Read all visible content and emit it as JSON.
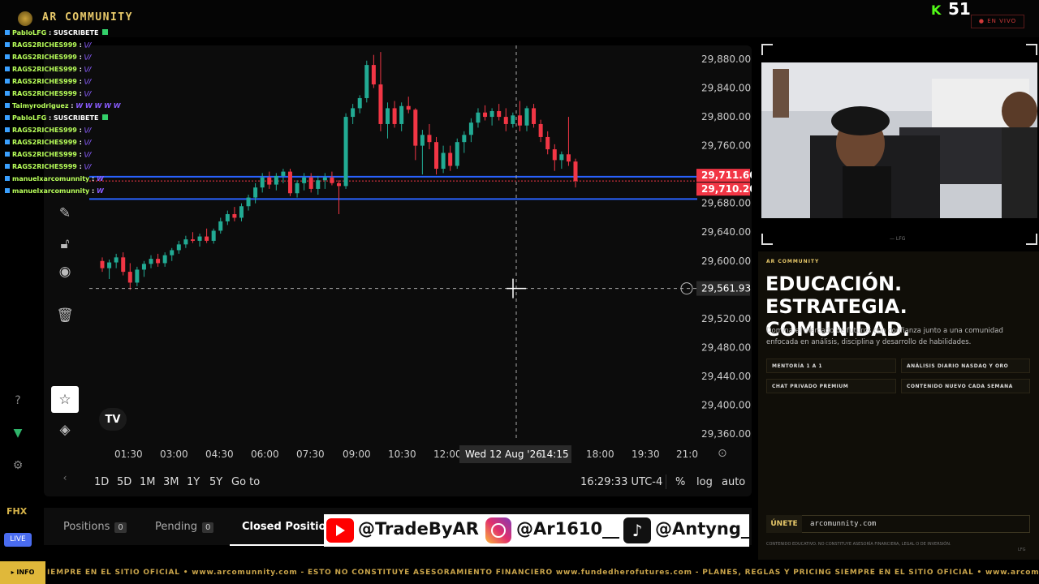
{
  "app": {
    "title": "AR COMMUNITY",
    "viewers": "51",
    "live_label": "● EN VIVO"
  },
  "chat": [
    {
      "user": "PabloLFG",
      "message": ": SUSCRIBETE",
      "sub": true
    },
    {
      "user": "RAGS2RICHES999",
      "message": ":",
      "emote": "\\//"
    },
    {
      "user": "RAGS2RICHES999",
      "message": ":",
      "emote": "\\//"
    },
    {
      "user": "RAGS2RICHES999",
      "message": ":",
      "emote": "\\//"
    },
    {
      "user": "RAGS2RICHES999",
      "message": ":",
      "emote": "\\//"
    },
    {
      "user": "RAGS2RICHES999",
      "message": ":",
      "emote": "\\//"
    },
    {
      "user": "Taimyrodriguez",
      "message": ":",
      "emote": "W W W W W"
    },
    {
      "user": "PabloLFG",
      "message": ": SUSCRIBETE",
      "sub": true
    },
    {
      "user": "RAGS2RICHES999",
      "message": ":",
      "emote": "\\//"
    },
    {
      "user": "RAGS2RICHES999",
      "message": ":",
      "emote": "\\//"
    },
    {
      "user": "RAGS2RICHES999",
      "message": ":",
      "emote": "\\//"
    },
    {
      "user": "RAGS2RICHES999",
      "message": ":",
      "emote": "\\//"
    },
    {
      "user": "manuelxarcomunnity",
      "message": ":",
      "emote": "W"
    },
    {
      "user": "manuelxarcomunnity",
      "message": ":",
      "emote": "W"
    }
  ],
  "chart_data": {
    "type": "candlestick",
    "price_axis": [
      "29,880.00",
      "29,840.00",
      "29,800.00",
      "29,760.00",
      "29,680.00",
      "29,640.00",
      "29,600.00",
      "29,520.00",
      "29,480.00",
      "29,440.00",
      "29,400.00",
      "29,360.00"
    ],
    "time_axis": [
      "01:30",
      "03:00",
      "04:30",
      "06:00",
      "07:30",
      "09:00",
      "10:30",
      "12:00",
      "18:00",
      "19:30",
      "21:0"
    ],
    "ylim": [
      29340,
      29900
    ],
    "price_labels": {
      "last_high": "29,711.60",
      "last": "29,710.20",
      "crosshair": "29,561.93"
    },
    "crosshair_time": "Wed 12 Aug '26",
    "crosshair_time2": "14:15",
    "horizontal_lines": [
      29717,
      29686
    ],
    "candles": [
      {
        "o": 29600,
        "h": 29605,
        "l": 29585,
        "c": 29590
      },
      {
        "o": 29590,
        "h": 29602,
        "l": 29575,
        "c": 29598
      },
      {
        "o": 29598,
        "h": 29610,
        "l": 29590,
        "c": 29605
      },
      {
        "o": 29605,
        "h": 29612,
        "l": 29580,
        "c": 29585
      },
      {
        "o": 29585,
        "h": 29597,
        "l": 29560,
        "c": 29570
      },
      {
        "o": 29570,
        "h": 29592,
        "l": 29565,
        "c": 29588
      },
      {
        "o": 29588,
        "h": 29600,
        "l": 29578,
        "c": 29596
      },
      {
        "o": 29596,
        "h": 29608,
        "l": 29590,
        "c": 29603
      },
      {
        "o": 29603,
        "h": 29610,
        "l": 29592,
        "c": 29597
      },
      {
        "o": 29597,
        "h": 29612,
        "l": 29592,
        "c": 29608
      },
      {
        "o": 29608,
        "h": 29618,
        "l": 29600,
        "c": 29615
      },
      {
        "o": 29615,
        "h": 29628,
        "l": 29610,
        "c": 29623
      },
      {
        "o": 29623,
        "h": 29635,
        "l": 29618,
        "c": 29630
      },
      {
        "o": 29630,
        "h": 29640,
        "l": 29625,
        "c": 29628
      },
      {
        "o": 29628,
        "h": 29638,
        "l": 29620,
        "c": 29634
      },
      {
        "o": 29634,
        "h": 29645,
        "l": 29625,
        "c": 29628
      },
      {
        "o": 29628,
        "h": 29645,
        "l": 29624,
        "c": 29642
      },
      {
        "o": 29642,
        "h": 29660,
        "l": 29638,
        "c": 29655
      },
      {
        "o": 29655,
        "h": 29670,
        "l": 29650,
        "c": 29665
      },
      {
        "o": 29665,
        "h": 29675,
        "l": 29655,
        "c": 29660
      },
      {
        "o": 29660,
        "h": 29680,
        "l": 29655,
        "c": 29676
      },
      {
        "o": 29676,
        "h": 29692,
        "l": 29670,
        "c": 29688
      },
      {
        "o": 29688,
        "h": 29708,
        "l": 29680,
        "c": 29702
      },
      {
        "o": 29702,
        "h": 29722,
        "l": 29695,
        "c": 29716
      },
      {
        "o": 29716,
        "h": 29724,
        "l": 29700,
        "c": 29706
      },
      {
        "o": 29706,
        "h": 29722,
        "l": 29698,
        "c": 29718
      },
      {
        "o": 29718,
        "h": 29728,
        "l": 29708,
        "c": 29724
      },
      {
        "o": 29724,
        "h": 29728,
        "l": 29690,
        "c": 29694
      },
      {
        "o": 29694,
        "h": 29712,
        "l": 29688,
        "c": 29708
      },
      {
        "o": 29708,
        "h": 29722,
        "l": 29698,
        "c": 29716
      },
      {
        "o": 29716,
        "h": 29722,
        "l": 29695,
        "c": 29700
      },
      {
        "o": 29700,
        "h": 29718,
        "l": 29692,
        "c": 29712
      },
      {
        "o": 29712,
        "h": 29722,
        "l": 29700,
        "c": 29716
      },
      {
        "o": 29716,
        "h": 29724,
        "l": 29705,
        "c": 29708
      },
      {
        "o": 29708,
        "h": 29712,
        "l": 29665,
        "c": 29704
      },
      {
        "o": 29704,
        "h": 29805,
        "l": 29700,
        "c": 29800
      },
      {
        "o": 29800,
        "h": 29818,
        "l": 29790,
        "c": 29812
      },
      {
        "o": 29812,
        "h": 29830,
        "l": 29805,
        "c": 29826
      },
      {
        "o": 29826,
        "h": 29878,
        "l": 29820,
        "c": 29872
      },
      {
        "o": 29872,
        "h": 29886,
        "l": 29840,
        "c": 29845
      },
      {
        "o": 29845,
        "h": 29890,
        "l": 29780,
        "c": 29790
      },
      {
        "o": 29790,
        "h": 29820,
        "l": 29770,
        "c": 29812
      },
      {
        "o": 29812,
        "h": 29822,
        "l": 29785,
        "c": 29790
      },
      {
        "o": 29790,
        "h": 29820,
        "l": 29780,
        "c": 29815
      },
      {
        "o": 29815,
        "h": 29828,
        "l": 29805,
        "c": 29810
      },
      {
        "o": 29810,
        "h": 29812,
        "l": 29740,
        "c": 29760
      },
      {
        "o": 29760,
        "h": 29782,
        "l": 29720,
        "c": 29775
      },
      {
        "o": 29775,
        "h": 29790,
        "l": 29755,
        "c": 29765
      },
      {
        "o": 29765,
        "h": 29772,
        "l": 29720,
        "c": 29728
      },
      {
        "o": 29728,
        "h": 29760,
        "l": 29722,
        "c": 29750
      },
      {
        "o": 29750,
        "h": 29760,
        "l": 29725,
        "c": 29732
      },
      {
        "o": 29732,
        "h": 29770,
        "l": 29728,
        "c": 29765
      },
      {
        "o": 29765,
        "h": 29780,
        "l": 29750,
        "c": 29775
      },
      {
        "o": 29775,
        "h": 29798,
        "l": 29765,
        "c": 29792
      },
      {
        "o": 29792,
        "h": 29812,
        "l": 29785,
        "c": 29806
      },
      {
        "o": 29806,
        "h": 29816,
        "l": 29795,
        "c": 29800
      },
      {
        "o": 29800,
        "h": 29812,
        "l": 29788,
        "c": 29808
      },
      {
        "o": 29808,
        "h": 29818,
        "l": 29795,
        "c": 29800
      },
      {
        "o": 29800,
        "h": 29812,
        "l": 29780,
        "c": 29790
      },
      {
        "o": 29790,
        "h": 29806,
        "l": 29785,
        "c": 29802
      },
      {
        "o": 29802,
        "h": 29822,
        "l": 29780,
        "c": 29788
      },
      {
        "o": 29788,
        "h": 29815,
        "l": 29780,
        "c": 29812
      },
      {
        "o": 29812,
        "h": 29818,
        "l": 29785,
        "c": 29790
      },
      {
        "o": 29790,
        "h": 29796,
        "l": 29765,
        "c": 29772
      },
      {
        "o": 29772,
        "h": 29780,
        "l": 29748,
        "c": 29755
      },
      {
        "o": 29755,
        "h": 29762,
        "l": 29725,
        "c": 29740
      },
      {
        "o": 29740,
        "h": 29752,
        "l": 29728,
        "c": 29748
      },
      {
        "o": 29748,
        "h": 29800,
        "l": 29732,
        "c": 29738
      },
      {
        "o": 29738,
        "h": 29742,
        "l": 29702,
        "c": 29711
      }
    ]
  },
  "periods": [
    "1D",
    "5D",
    "1M",
    "3M",
    "1Y",
    "5Y",
    "Go to"
  ],
  "clock": "16:29:33 UTC-4",
  "scale_opts": [
    "%",
    "log",
    "auto"
  ],
  "tabs": [
    {
      "label": "Positions",
      "count": "0"
    },
    {
      "label": "Pending",
      "count": "0"
    },
    {
      "label": "Closed Positions"
    }
  ],
  "social": [
    "@TradeByAR",
    "@Ar1610__",
    "@Antyng_"
  ],
  "side": {
    "live_btn": "LIVE",
    "fhx": "FHX"
  },
  "panel": {
    "kicker": "AR COMMUNITY",
    "cam_label": "— LFG",
    "title": "EDUCACIÓN. ESTRATEGIA. COMUNIDAD.",
    "desc": "Domina el mercado de futuros con confianza junto a una comunidad enfocada en análisis, disciplina y desarrollo de habilidades.",
    "features": [
      "MENTORÍA 1 A 1",
      "ANÁLISIS DIARIO NASDAQ Y ORO",
      "CHAT PRIVADO PREMIUM",
      "CONTENIDO NUEVO CADA SEMANA"
    ],
    "join_label": "ÚNETE",
    "join_url": "arcomunnity.com",
    "disclaimer": "CONTENIDO EDUCATIVO. NO CONSTITUYE ASESORÍA FINANCIERA, LEGAL O DE INVERSIÓN.",
    "footer_tag": "LFG"
  },
  "ticker": {
    "label": "▸ INFO",
    "text": "IEMPRE EN EL SITIO OFICIAL   •   www.arcomunnity.com   -   ESTO NO CONSTITUYE ASESORAMIENTO FINANCIERO          www.fundedherofutures.com   -   PLANES, REGLAS Y PRICING SIEMPRE EN EL SITIO OFICIAL   •   www.arcomunn"
  },
  "colors": {
    "up": "#22ab94",
    "down": "#f23645",
    "hline": "#2962ff",
    "gold": "#e8c96a",
    "live": "#d23a3a"
  }
}
